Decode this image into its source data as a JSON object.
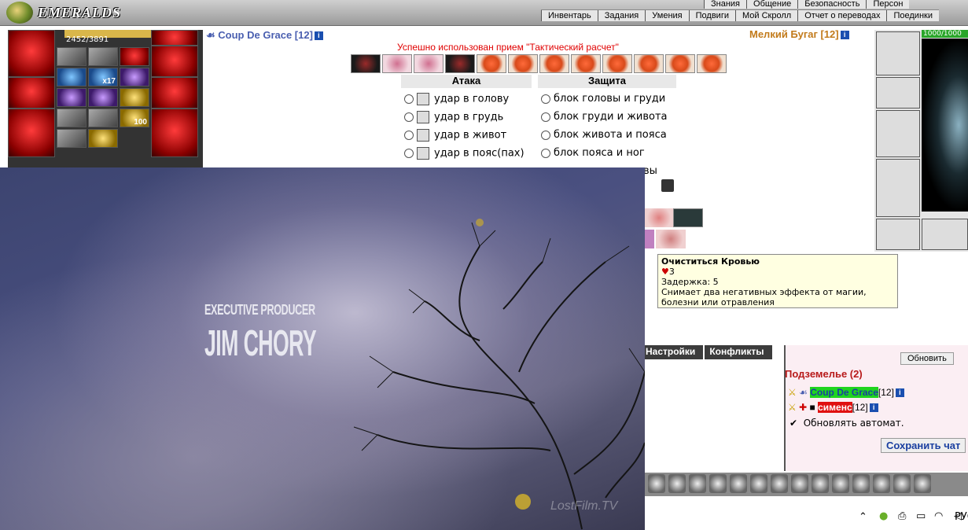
{
  "header": {
    "logo_text": "EMERALDS",
    "menu_top": [
      "Знания",
      "Общение",
      "Безопасность",
      "Персон"
    ],
    "menu_bottom": [
      "Инвентарь",
      "Задания",
      "Умения",
      "Подвиги",
      "Мой Скролл",
      "Отчет о переводах",
      "Поединки"
    ]
  },
  "player_left": {
    "hp": "2452/3891",
    "name": "Coup De Grace [12]",
    "info_icon": "i"
  },
  "player_right": {
    "hp": "1000/1000",
    "name": "Мелкий Бугаг [12]",
    "info_icon": "i"
  },
  "equipment_badges": {
    "count": "x17",
    "value": "100"
  },
  "combat": {
    "success_message": "Успешно использован прием \"Тактический расчет\"",
    "attack_header": "Атака",
    "defense_header": "Защита",
    "attack_options": [
      "удар в голову",
      "удар в грудь",
      "удар в живот",
      "удар в пояс(пах)"
    ],
    "defense_options": [
      "блок головы и груди",
      "блок груди и живота",
      "блок живота и пояса",
      "блок пояса и ног"
    ],
    "partial_text": "вы"
  },
  "tooltip": {
    "title": "Очиститься Кровью",
    "cost": "3",
    "delay": "Задержка: 5",
    "description": "Снимает два негативных эффекта от магии, болезни или отравления"
  },
  "tabs": [
    "Настройки",
    "Конфликты"
  ],
  "online": {
    "refresh_label": "Обновить",
    "location": "Подземелье (2)",
    "users": [
      {
        "name": "Coup De Grace",
        "level": "[12]",
        "info": "i",
        "color": "#1fd41f"
      },
      {
        "name": "сименс",
        "level": "[12]",
        "info": "i",
        "color": "#e01010"
      }
    ],
    "auto_refresh_label": "Обновлять автомат.",
    "save_chat_label": "Сохранить чат"
  },
  "video": {
    "credit_role": "EXECUTIVE PRODUCER",
    "credit_name": "JIM CHORY",
    "watermark": "LostFilm.TV"
  },
  "taskbar": {
    "language": "РУС"
  }
}
